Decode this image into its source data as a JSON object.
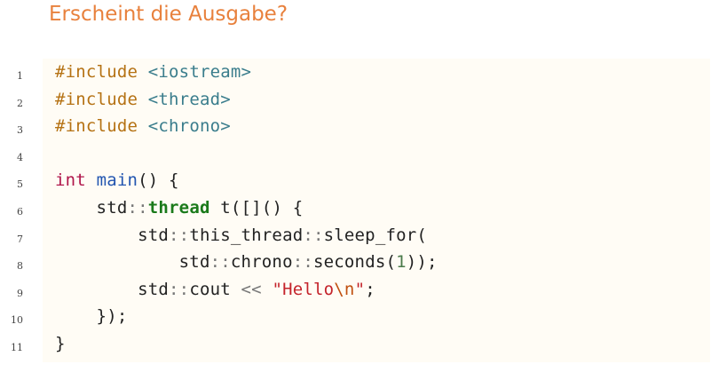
{
  "title": "Erscheint die Ausgabe?",
  "code": {
    "lines": [
      {
        "number": "1",
        "tokens": [
          {
            "t": "#include",
            "c": "tok-pp"
          },
          {
            "t": " ",
            "c": "tok-plain"
          },
          {
            "t": "<iostream>",
            "c": "tok-inc"
          }
        ]
      },
      {
        "number": "2",
        "tokens": [
          {
            "t": "#include",
            "c": "tok-pp"
          },
          {
            "t": " ",
            "c": "tok-plain"
          },
          {
            "t": "<thread>",
            "c": "tok-inc"
          }
        ]
      },
      {
        "number": "3",
        "tokens": [
          {
            "t": "#include",
            "c": "tok-pp"
          },
          {
            "t": " ",
            "c": "tok-plain"
          },
          {
            "t": "<chrono>",
            "c": "tok-inc"
          }
        ]
      },
      {
        "number": "4",
        "tokens": []
      },
      {
        "number": "5",
        "tokens": [
          {
            "t": "int",
            "c": "tok-kw"
          },
          {
            "t": " ",
            "c": "tok-plain"
          },
          {
            "t": "main",
            "c": "tok-fn"
          },
          {
            "t": "() {",
            "c": "tok-plain"
          }
        ]
      },
      {
        "number": "6",
        "tokens": [
          {
            "t": "    std",
            "c": "tok-plain"
          },
          {
            "t": "::",
            "c": "tok-op"
          },
          {
            "t": "thread",
            "c": "tok-type"
          },
          {
            "t": " t([]() {",
            "c": "tok-plain"
          }
        ]
      },
      {
        "number": "7",
        "tokens": [
          {
            "t": "        std",
            "c": "tok-plain"
          },
          {
            "t": "::",
            "c": "tok-op"
          },
          {
            "t": "this_thread",
            "c": "tok-plain"
          },
          {
            "t": "::",
            "c": "tok-op"
          },
          {
            "t": "sleep_for(",
            "c": "tok-plain"
          }
        ]
      },
      {
        "number": "8",
        "tokens": [
          {
            "t": "            std",
            "c": "tok-plain"
          },
          {
            "t": "::",
            "c": "tok-op"
          },
          {
            "t": "chrono",
            "c": "tok-plain"
          },
          {
            "t": "::",
            "c": "tok-op"
          },
          {
            "t": "seconds(",
            "c": "tok-plain"
          },
          {
            "t": "1",
            "c": "tok-num"
          },
          {
            "t": "));",
            "c": "tok-plain"
          }
        ]
      },
      {
        "number": "9",
        "tokens": [
          {
            "t": "        std",
            "c": "tok-plain"
          },
          {
            "t": "::",
            "c": "tok-op"
          },
          {
            "t": "cout ",
            "c": "tok-plain"
          },
          {
            "t": "<<",
            "c": "tok-op"
          },
          {
            "t": " ",
            "c": "tok-plain"
          },
          {
            "t": "\"Hello",
            "c": "tok-str"
          },
          {
            "t": "\\n",
            "c": "tok-esc"
          },
          {
            "t": "\"",
            "c": "tok-str"
          },
          {
            "t": ";",
            "c": "tok-plain"
          }
        ]
      },
      {
        "number": "10",
        "tokens": [
          {
            "t": "    });",
            "c": "tok-plain"
          }
        ]
      },
      {
        "number": "11",
        "tokens": [
          {
            "t": "}",
            "c": "tok-plain"
          }
        ]
      }
    ]
  },
  "colors": {
    "title": "#e8813d",
    "code_background": "#fffcf5",
    "preprocessor": "#b57214",
    "include_path": "#3a7d8c",
    "keyword": "#b0154a",
    "function": "#2255b0",
    "type": "#1a7a1a",
    "string": "#c4232b"
  }
}
